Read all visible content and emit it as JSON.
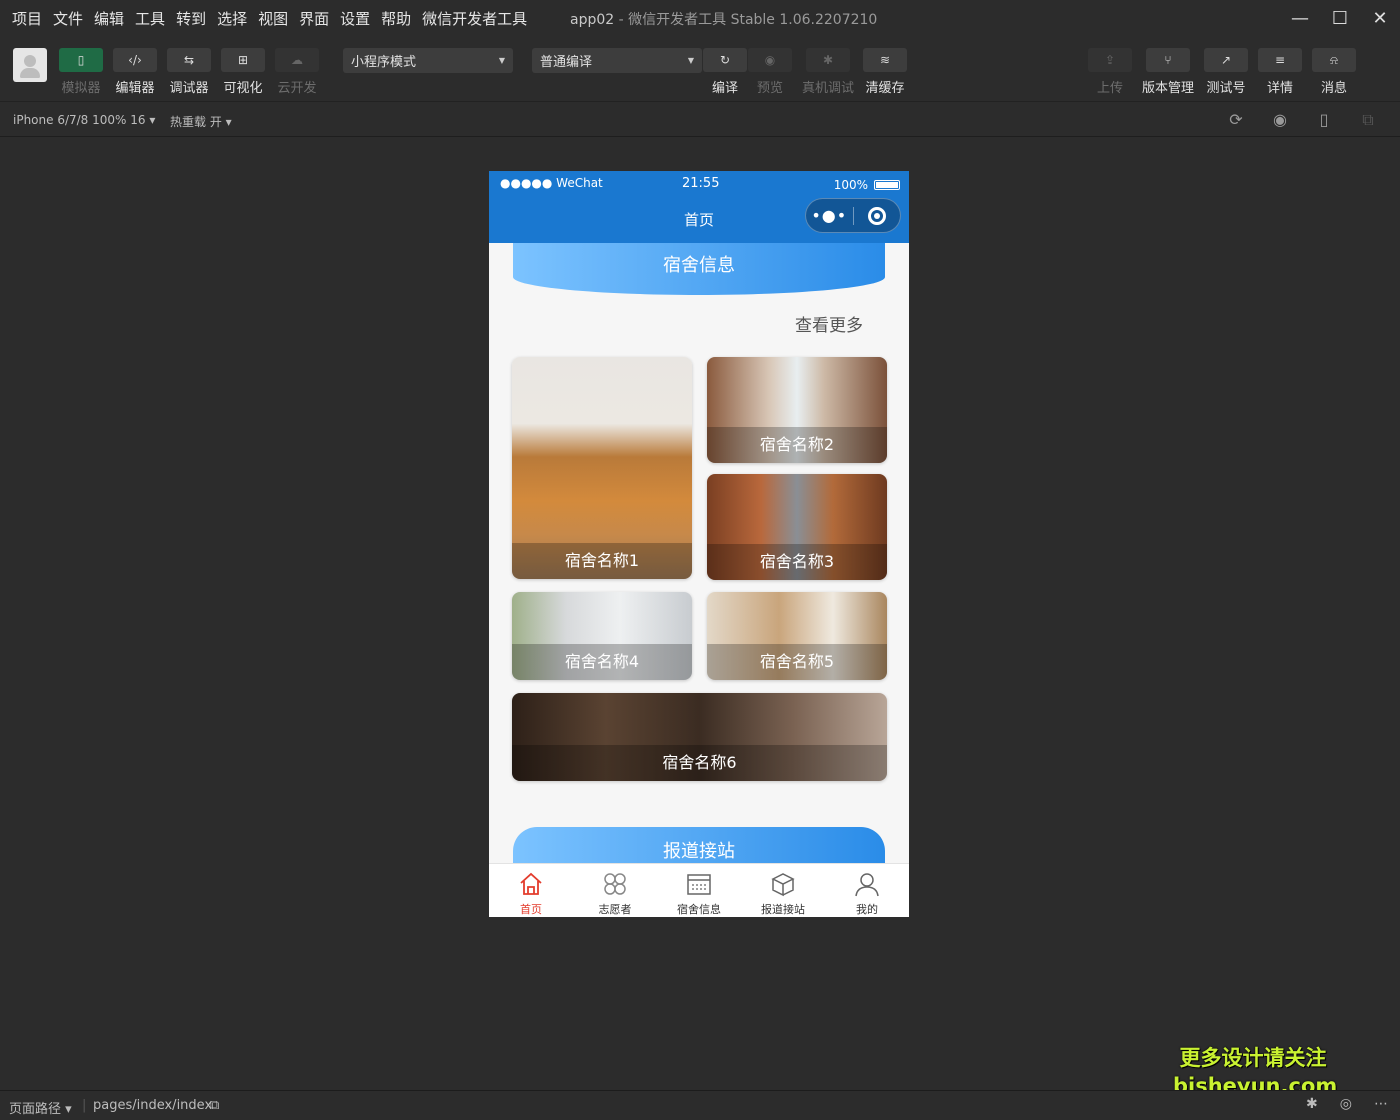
{
  "menubar": {
    "items": [
      "项目",
      "文件",
      "编辑",
      "工具",
      "转到",
      "选择",
      "视图",
      "界面",
      "设置",
      "帮助",
      "微信开发者工具"
    ],
    "app_name": "app02",
    "title_rest": " - 微信开发者工具 Stable 1.06.2207210"
  },
  "toolbar": {
    "left_buttons": [
      {
        "label": "模拟器",
        "icon": "phone-icon",
        "glyph": "▯",
        "active": true,
        "disabled": false
      },
      {
        "label": "编辑器",
        "icon": "code-icon",
        "glyph": "‹/›",
        "active": false,
        "disabled": false
      },
      {
        "label": "调试器",
        "icon": "debug-icon",
        "glyph": "⇆",
        "active": false,
        "disabled": false
      },
      {
        "label": "可视化",
        "icon": "layout-icon",
        "glyph": "⊞",
        "active": false,
        "disabled": false
      },
      {
        "label": "云开发",
        "icon": "cloud-icon",
        "glyph": "☁",
        "active": false,
        "disabled": true
      }
    ],
    "mode_select": "小程序模式",
    "compile_select": "普通编译",
    "middle_buttons": [
      {
        "label": "编译",
        "icon": "refresh-icon",
        "glyph": "↻",
        "disabled": false
      },
      {
        "label": "预览",
        "icon": "eye-icon",
        "glyph": "◉",
        "disabled": true
      },
      {
        "label": "真机调试",
        "icon": "bug-icon",
        "glyph": "✱",
        "disabled": true
      },
      {
        "label": "清缓存",
        "icon": "layers-icon",
        "glyph": "≋",
        "disabled": false
      }
    ],
    "right_buttons": [
      {
        "label": "上传",
        "icon": "upload-icon",
        "glyph": "⇪",
        "disabled": true
      },
      {
        "label": "版本管理",
        "icon": "branch-icon",
        "glyph": "⑂",
        "disabled": false
      },
      {
        "label": "测试号",
        "icon": "external-link-icon",
        "glyph": "↗",
        "disabled": false
      },
      {
        "label": "详情",
        "icon": "menu-icon",
        "glyph": "≡",
        "disabled": false
      },
      {
        "label": "消息",
        "icon": "bell-icon",
        "glyph": "🔔",
        "disabled": false
      }
    ]
  },
  "devicebar": {
    "device": "iPhone 6/7/8 100% 16 ▾",
    "hot_reload": "热重载 开 ▾"
  },
  "phone": {
    "status": {
      "carrier": "●●●●● WeChat",
      "time": "21:55",
      "battery": "100%"
    },
    "nav_title": "首页",
    "section1_title": "宿舍信息",
    "more_link": "查看更多",
    "cards": [
      {
        "name": "宿舍名称1"
      },
      {
        "name": "宿舍名称2"
      },
      {
        "name": "宿舍名称3"
      },
      {
        "name": "宿舍名称4"
      },
      {
        "name": "宿舍名称5"
      },
      {
        "name": "宿舍名称6"
      }
    ],
    "section2_title": "报道接站",
    "tabs": [
      {
        "label": "首页",
        "icon": "home-icon",
        "active": true
      },
      {
        "label": "志愿者",
        "icon": "clover-icon",
        "active": false
      },
      {
        "label": "宿舍信息",
        "icon": "calendar-icon",
        "active": false
      },
      {
        "label": "报道接站",
        "icon": "box-icon",
        "active": false
      },
      {
        "label": "我的",
        "icon": "user-icon",
        "active": false
      }
    ]
  },
  "statusbar": {
    "path_label": "页面路径 ▾",
    "path_value": "pages/index/index"
  },
  "watermark": {
    "line1": "更多设计请关注",
    "line2": "bisheyun.com"
  },
  "colors": {
    "accent_blue": "#1a78d0",
    "active_red": "#e33c2d",
    "green": "#1f6b45"
  }
}
